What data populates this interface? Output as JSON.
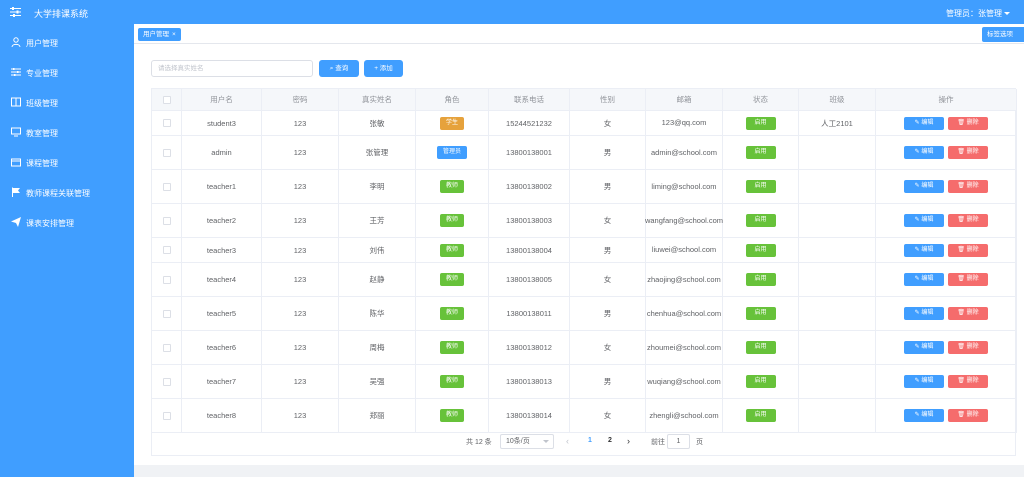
{
  "app": {
    "title": "大学排课系统",
    "admin_label": "管理员：张管理"
  },
  "sidebar": {
    "items": [
      {
        "label": "用户管理",
        "icon": "user-icon"
      },
      {
        "label": "专业管理",
        "icon": "sliders-icon"
      },
      {
        "label": "班级管理",
        "icon": "columns-icon"
      },
      {
        "label": "教室管理",
        "icon": "monitor-icon"
      },
      {
        "label": "课程管理",
        "icon": "folder-icon"
      },
      {
        "label": "教师课程关联管理",
        "icon": "flag-icon"
      },
      {
        "label": "课表安排管理",
        "icon": "send-icon"
      }
    ]
  },
  "tabs": {
    "active": "用户管理",
    "close": "×",
    "options": "标签选项"
  },
  "toolbar": {
    "search_placeholder": "请选择真实姓名",
    "query_label": "查询",
    "add_label": "添加"
  },
  "table": {
    "columns": [
      "用户名",
      "密码",
      "真实姓名",
      "角色",
      "联系电话",
      "性别",
      "邮箱",
      "状态",
      "班级",
      "操作"
    ],
    "edit_label": "编辑",
    "delete_label": "删除",
    "rows": [
      {
        "username": "student3",
        "password": "123",
        "realname": "张敏",
        "role": "学生",
        "role_type": "student",
        "phone": "15244521232",
        "gender": "女",
        "email": "123@qq.com",
        "status": "启用",
        "class": "人工2101"
      },
      {
        "username": "admin",
        "password": "123",
        "realname": "张管理",
        "role": "管理员",
        "role_type": "admin",
        "phone": "13800138001",
        "gender": "男",
        "email": "admin@school.com",
        "status": "启用",
        "class": ""
      },
      {
        "username": "teacher1",
        "password": "123",
        "realname": "李明",
        "role": "教师",
        "role_type": "teacher",
        "phone": "13800138002",
        "gender": "男",
        "email": "liming@school.com",
        "status": "启用",
        "class": ""
      },
      {
        "username": "teacher2",
        "password": "123",
        "realname": "王芳",
        "role": "教师",
        "role_type": "teacher",
        "phone": "13800138003",
        "gender": "女",
        "email": "wangfang@school.com",
        "status": "启用",
        "class": ""
      },
      {
        "username": "teacher3",
        "password": "123",
        "realname": "刘伟",
        "role": "教师",
        "role_type": "teacher",
        "phone": "13800138004",
        "gender": "男",
        "email": "liuwei@school.com",
        "status": "启用",
        "class": ""
      },
      {
        "username": "teacher4",
        "password": "123",
        "realname": "赵静",
        "role": "教师",
        "role_type": "teacher",
        "phone": "13800138005",
        "gender": "女",
        "email": "zhaojing@school.com",
        "status": "启用",
        "class": ""
      },
      {
        "username": "teacher5",
        "password": "123",
        "realname": "陈华",
        "role": "教师",
        "role_type": "teacher",
        "phone": "13800138011",
        "gender": "男",
        "email": "chenhua@school.com",
        "status": "启用",
        "class": ""
      },
      {
        "username": "teacher6",
        "password": "123",
        "realname": "周梅",
        "role": "教师",
        "role_type": "teacher",
        "phone": "13800138012",
        "gender": "女",
        "email": "zhoumei@school.com",
        "status": "启用",
        "class": ""
      },
      {
        "username": "teacher7",
        "password": "123",
        "realname": "吴强",
        "role": "教师",
        "role_type": "teacher",
        "phone": "13800138013",
        "gender": "男",
        "email": "wuqiang@school.com",
        "status": "启用",
        "class": ""
      },
      {
        "username": "teacher8",
        "password": "123",
        "realname": "郑丽",
        "role": "教师",
        "role_type": "teacher",
        "phone": "13800138014",
        "gender": "女",
        "email": "zhengli@school.com",
        "status": "启用",
        "class": ""
      }
    ]
  },
  "pagination": {
    "total": "共 12 条",
    "page_size": "10条/页",
    "pages": [
      "1",
      "2"
    ],
    "current": "1",
    "goto_label": "前往",
    "goto_value": "1",
    "page_unit": "页"
  },
  "colors": {
    "primary": "#409eff",
    "success": "#67c23a",
    "warning": "#e6a23c",
    "danger": "#f56c6c"
  }
}
